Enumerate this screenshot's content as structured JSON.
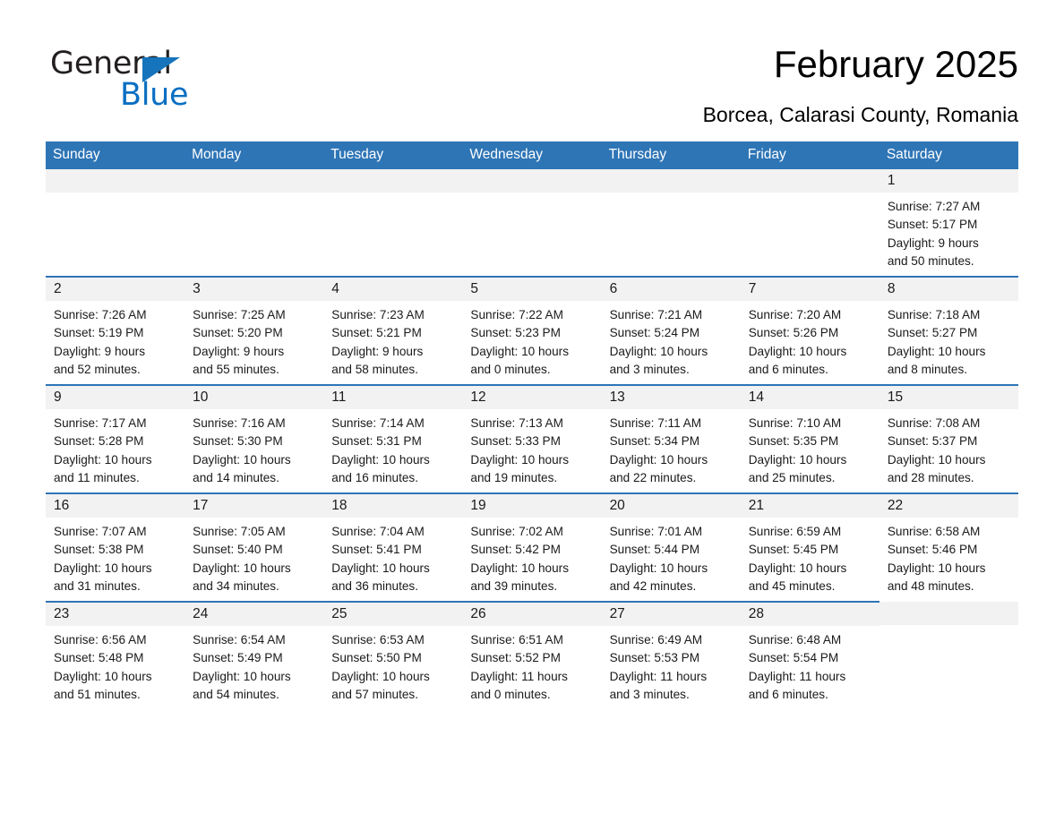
{
  "logo": {
    "word1": "General",
    "word2": "Blue",
    "triangle_color": "#1574bb",
    "blue_color": "#0a6fc2"
  },
  "header": {
    "title": "February 2025",
    "subtitle": "Borcea, Calarasi County, Romania"
  },
  "theme": {
    "header_blue": "#2e75b6",
    "daynum_gray": "#f2f2f2",
    "text": "#1a1a1a"
  },
  "calendar": {
    "weekdays": [
      "Sunday",
      "Monday",
      "Tuesday",
      "Wednesday",
      "Thursday",
      "Friday",
      "Saturday"
    ],
    "weeks": [
      [
        {
          "day": "",
          "sunrise": "",
          "sunset": "",
          "daylight": "",
          "daylight2": ""
        },
        {
          "day": "",
          "sunrise": "",
          "sunset": "",
          "daylight": "",
          "daylight2": ""
        },
        {
          "day": "",
          "sunrise": "",
          "sunset": "",
          "daylight": "",
          "daylight2": ""
        },
        {
          "day": "",
          "sunrise": "",
          "sunset": "",
          "daylight": "",
          "daylight2": ""
        },
        {
          "day": "",
          "sunrise": "",
          "sunset": "",
          "daylight": "",
          "daylight2": ""
        },
        {
          "day": "",
          "sunrise": "",
          "sunset": "",
          "daylight": "",
          "daylight2": ""
        },
        {
          "day": "1",
          "sunrise": "Sunrise: 7:27 AM",
          "sunset": "Sunset: 5:17 PM",
          "daylight": "Daylight: 9 hours",
          "daylight2": "and 50 minutes."
        }
      ],
      [
        {
          "day": "2",
          "sunrise": "Sunrise: 7:26 AM",
          "sunset": "Sunset: 5:19 PM",
          "daylight": "Daylight: 9 hours",
          "daylight2": "and 52 minutes."
        },
        {
          "day": "3",
          "sunrise": "Sunrise: 7:25 AM",
          "sunset": "Sunset: 5:20 PM",
          "daylight": "Daylight: 9 hours",
          "daylight2": "and 55 minutes."
        },
        {
          "day": "4",
          "sunrise": "Sunrise: 7:23 AM",
          "sunset": "Sunset: 5:21 PM",
          "daylight": "Daylight: 9 hours",
          "daylight2": "and 58 minutes."
        },
        {
          "day": "5",
          "sunrise": "Sunrise: 7:22 AM",
          "sunset": "Sunset: 5:23 PM",
          "daylight": "Daylight: 10 hours",
          "daylight2": "and 0 minutes."
        },
        {
          "day": "6",
          "sunrise": "Sunrise: 7:21 AM",
          "sunset": "Sunset: 5:24 PM",
          "daylight": "Daylight: 10 hours",
          "daylight2": "and 3 minutes."
        },
        {
          "day": "7",
          "sunrise": "Sunrise: 7:20 AM",
          "sunset": "Sunset: 5:26 PM",
          "daylight": "Daylight: 10 hours",
          "daylight2": "and 6 minutes."
        },
        {
          "day": "8",
          "sunrise": "Sunrise: 7:18 AM",
          "sunset": "Sunset: 5:27 PM",
          "daylight": "Daylight: 10 hours",
          "daylight2": "and 8 minutes."
        }
      ],
      [
        {
          "day": "9",
          "sunrise": "Sunrise: 7:17 AM",
          "sunset": "Sunset: 5:28 PM",
          "daylight": "Daylight: 10 hours",
          "daylight2": "and 11 minutes."
        },
        {
          "day": "10",
          "sunrise": "Sunrise: 7:16 AM",
          "sunset": "Sunset: 5:30 PM",
          "daylight": "Daylight: 10 hours",
          "daylight2": "and 14 minutes."
        },
        {
          "day": "11",
          "sunrise": "Sunrise: 7:14 AM",
          "sunset": "Sunset: 5:31 PM",
          "daylight": "Daylight: 10 hours",
          "daylight2": "and 16 minutes."
        },
        {
          "day": "12",
          "sunrise": "Sunrise: 7:13 AM",
          "sunset": "Sunset: 5:33 PM",
          "daylight": "Daylight: 10 hours",
          "daylight2": "and 19 minutes."
        },
        {
          "day": "13",
          "sunrise": "Sunrise: 7:11 AM",
          "sunset": "Sunset: 5:34 PM",
          "daylight": "Daylight: 10 hours",
          "daylight2": "and 22 minutes."
        },
        {
          "day": "14",
          "sunrise": "Sunrise: 7:10 AM",
          "sunset": "Sunset: 5:35 PM",
          "daylight": "Daylight: 10 hours",
          "daylight2": "and 25 minutes."
        },
        {
          "day": "15",
          "sunrise": "Sunrise: 7:08 AM",
          "sunset": "Sunset: 5:37 PM",
          "daylight": "Daylight: 10 hours",
          "daylight2": "and 28 minutes."
        }
      ],
      [
        {
          "day": "16",
          "sunrise": "Sunrise: 7:07 AM",
          "sunset": "Sunset: 5:38 PM",
          "daylight": "Daylight: 10 hours",
          "daylight2": "and 31 minutes."
        },
        {
          "day": "17",
          "sunrise": "Sunrise: 7:05 AM",
          "sunset": "Sunset: 5:40 PM",
          "daylight": "Daylight: 10 hours",
          "daylight2": "and 34 minutes."
        },
        {
          "day": "18",
          "sunrise": "Sunrise: 7:04 AM",
          "sunset": "Sunset: 5:41 PM",
          "daylight": "Daylight: 10 hours",
          "daylight2": "and 36 minutes."
        },
        {
          "day": "19",
          "sunrise": "Sunrise: 7:02 AM",
          "sunset": "Sunset: 5:42 PM",
          "daylight": "Daylight: 10 hours",
          "daylight2": "and 39 minutes."
        },
        {
          "day": "20",
          "sunrise": "Sunrise: 7:01 AM",
          "sunset": "Sunset: 5:44 PM",
          "daylight": "Daylight: 10 hours",
          "daylight2": "and 42 minutes."
        },
        {
          "day": "21",
          "sunrise": "Sunrise: 6:59 AM",
          "sunset": "Sunset: 5:45 PM",
          "daylight": "Daylight: 10 hours",
          "daylight2": "and 45 minutes."
        },
        {
          "day": "22",
          "sunrise": "Sunrise: 6:58 AM",
          "sunset": "Sunset: 5:46 PM",
          "daylight": "Daylight: 10 hours",
          "daylight2": "and 48 minutes."
        }
      ],
      [
        {
          "day": "23",
          "sunrise": "Sunrise: 6:56 AM",
          "sunset": "Sunset: 5:48 PM",
          "daylight": "Daylight: 10 hours",
          "daylight2": "and 51 minutes."
        },
        {
          "day": "24",
          "sunrise": "Sunrise: 6:54 AM",
          "sunset": "Sunset: 5:49 PM",
          "daylight": "Daylight: 10 hours",
          "daylight2": "and 54 minutes."
        },
        {
          "day": "25",
          "sunrise": "Sunrise: 6:53 AM",
          "sunset": "Sunset: 5:50 PM",
          "daylight": "Daylight: 10 hours",
          "daylight2": "and 57 minutes."
        },
        {
          "day": "26",
          "sunrise": "Sunrise: 6:51 AM",
          "sunset": "Sunset: 5:52 PM",
          "daylight": "Daylight: 11 hours",
          "daylight2": "and 0 minutes."
        },
        {
          "day": "27",
          "sunrise": "Sunrise: 6:49 AM",
          "sunset": "Sunset: 5:53 PM",
          "daylight": "Daylight: 11 hours",
          "daylight2": "and 3 minutes."
        },
        {
          "day": "28",
          "sunrise": "Sunrise: 6:48 AM",
          "sunset": "Sunset: 5:54 PM",
          "daylight": "Daylight: 11 hours",
          "daylight2": "and 6 minutes."
        },
        {
          "day": "",
          "sunrise": "",
          "sunset": "",
          "daylight": "",
          "daylight2": ""
        }
      ]
    ]
  }
}
